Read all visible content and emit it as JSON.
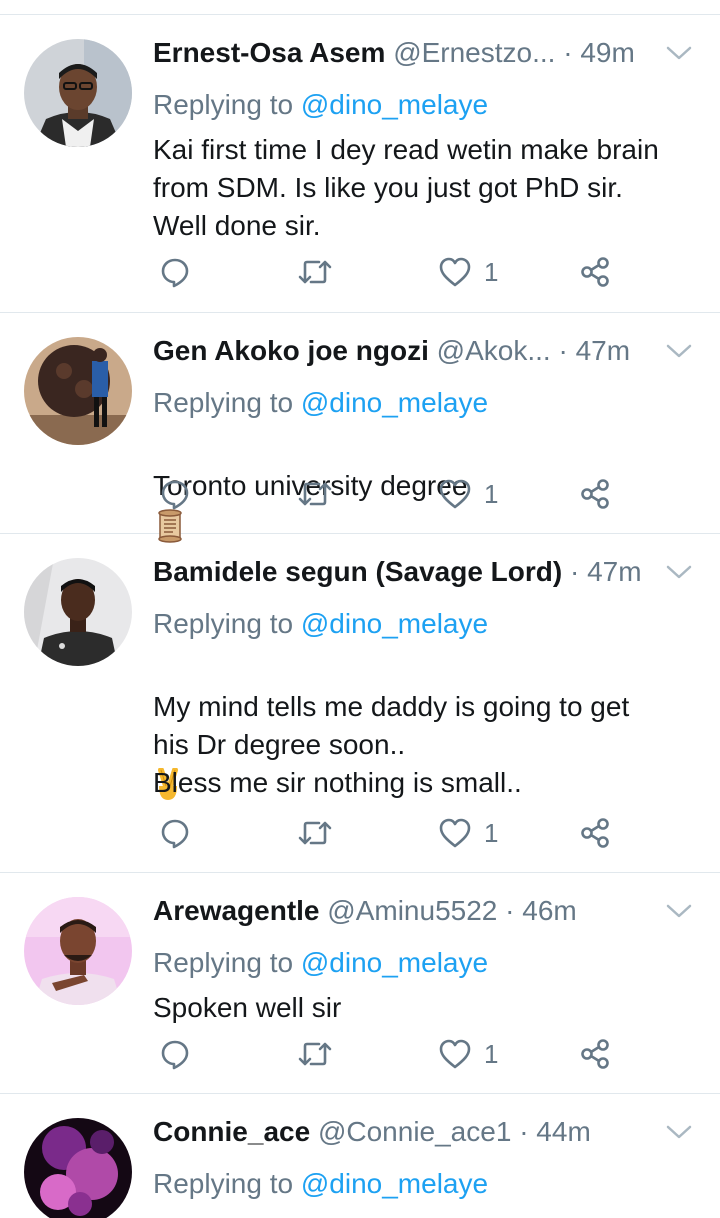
{
  "tweets": [
    {
      "name": "Ernest-Osa Asem",
      "handle": "@Ernestzo...",
      "dot": "·",
      "time": "49m",
      "replying_prefix": "Replying to ",
      "replying_handle": "@dino_melaye",
      "body": "Kai first time I dey read wetin make brain\nfrom SDM. Is like you just got PhD sir.\nWell done sir.",
      "likes": "1",
      "avatar_colors": [
        "#c9ccd1",
        "#3b3b3b"
      ]
    },
    {
      "name": "Gen Akoko joe ngozi",
      "handle": "@Akok...",
      "dot": "·",
      "time": "47m",
      "replying_prefix": "Replying to ",
      "replying_handle": "@dino_melaye",
      "body": "Toronto university degree",
      "body_emoji": "scroll-icon",
      "likes": "1",
      "avatar_colors": [
        "#6b4a3a",
        "#2b1f1a"
      ]
    },
    {
      "name": "Bamidele segun (Savage Lord)",
      "handle": "",
      "dot": "·",
      "time": "47m",
      "replying_prefix": "Replying to ",
      "replying_handle": "@dino_melaye",
      "body": "My mind tells me daddy is going to get\nhis Dr degree soon..",
      "body_emoji": "victory-hand-icon",
      "body2": "Bless me sir nothing is small..",
      "likes": "1",
      "avatar_colors": [
        "#e6e6e6",
        "#2a2a2a"
      ]
    },
    {
      "name": "Arewagentle",
      "handle": "@Aminu5522",
      "dot": "·",
      "time": "46m",
      "replying_prefix": "Replying to ",
      "replying_handle": "@dino_melaye",
      "body": "Spoken well sir",
      "likes": "1",
      "avatar_colors": [
        "#f2b6e6",
        "#6b3b2a"
      ]
    },
    {
      "name": "Connie_ace",
      "handle": "@Connie_ace1",
      "dot": "·",
      "time": "44m",
      "replying_prefix": "Replying to ",
      "replying_handle": "@dino_melaye",
      "avatar_colors": [
        "#1a0a1f",
        "#c24fb0"
      ]
    }
  ],
  "colors": {
    "link": "#1da1f2",
    "muted": "#657786",
    "text": "#14171a",
    "divider": "#e1e8ed"
  },
  "icons": [
    "reply-icon",
    "retweet-icon",
    "like-icon",
    "share-icon",
    "chevron-down-icon"
  ]
}
